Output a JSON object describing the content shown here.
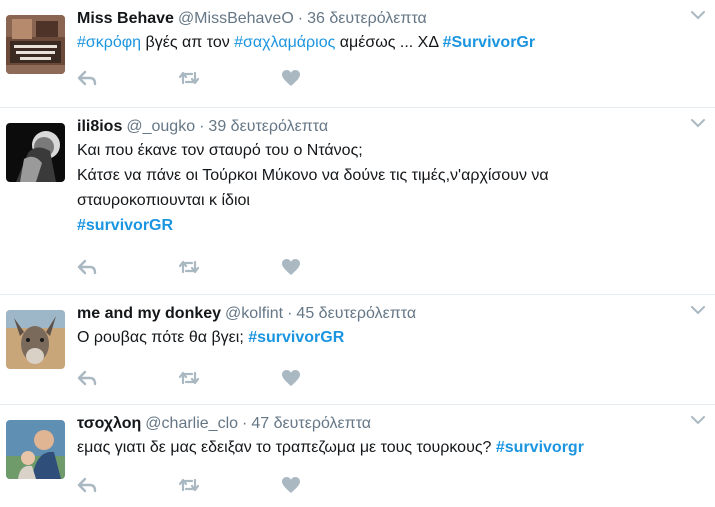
{
  "tweets": [
    {
      "fullname": "Miss Behave",
      "username": "@MissBehaveO",
      "time": "36 δευτερόλεπτα",
      "avatar": "avatar-missbehave",
      "parts": [
        {
          "t": "#σκρόφη",
          "tag": true,
          "bold": false
        },
        {
          "t": " βγές απ τον ",
          "tag": false
        },
        {
          "t": "#σαχλαμάριος",
          "tag": true,
          "bold": false
        },
        {
          "t": " αμέσως ... ΧΔ ",
          "tag": false
        },
        {
          "t": "#SurvivorGr",
          "tag": true,
          "bold": true
        }
      ]
    },
    {
      "fullname": "ili8ios",
      "username": "@_ougko",
      "time": "39 δευτερόλεπτα",
      "avatar": "avatar-ili8ios",
      "parts": [
        {
          "t": "Και που έκανε τον σταυρό του ο Ντάνος;",
          "tag": false,
          "br": true
        },
        {
          "t": "Κάτσε να πάνε οι Τούρκοι Μύκονο να δούνε τις τιμές,ν'αρχίσουν να σταυροκοπιουνται κ ίδιοι",
          "tag": false,
          "br": true
        },
        {
          "t": "#survivorGR",
          "tag": true,
          "bold": true
        }
      ]
    },
    {
      "fullname": "me and my donkey",
      "username": "@kolfint",
      "time": "45 δευτερόλεπτα",
      "avatar": "avatar-donkey",
      "parts": [
        {
          "t": "Ο ρουβας πότε θα βγει; ",
          "tag": false
        },
        {
          "t": "#survivorGR",
          "tag": true,
          "bold": true
        }
      ]
    },
    {
      "fullname": "τσοχλοη",
      "username": "@charlie_clo",
      "time": "47 δευτερόλεπτα",
      "avatar": "avatar-tsoxloh",
      "parts": [
        {
          "t": "εμας γιατι δε μας εδειξαν το τραπεζωμα με τους τουρκους? ",
          "tag": false
        },
        {
          "t": "#survivorgr",
          "tag": true,
          "bold": true
        }
      ]
    }
  ],
  "icons": {
    "reply": "reply-icon",
    "retweet": "retweet-icon",
    "like": "heart-icon",
    "menu": "chevron-down-icon"
  },
  "colors": {
    "hashtag": "#1b95e0",
    "muted": "#657786",
    "icon": "#aab8c2",
    "divider": "#e6ecf0"
  },
  "separator": "·"
}
